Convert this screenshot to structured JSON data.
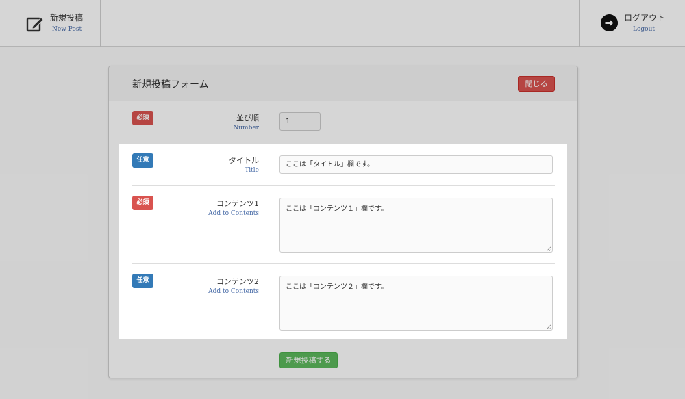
{
  "header": {
    "new_post_ja": "新規投稿",
    "new_post_en": "New Post",
    "new_post_icon": "edit-icon",
    "logout_ja": "ログアウト",
    "logout_en": "Logout",
    "logout_icon": "arrow-right-circle-icon"
  },
  "form": {
    "title": "新規投稿フォーム",
    "close_label": "閉じる",
    "submit_label": "新規投稿する",
    "fields": [
      {
        "badge": "必須",
        "badge_kind": "required",
        "label": "並び順",
        "sub": "Number",
        "value": "1",
        "type": "text"
      },
      {
        "badge": "任意",
        "badge_kind": "optional",
        "label": "タイトル",
        "sub": "Title",
        "value": "ここは「タイトル」欄です。",
        "type": "text"
      },
      {
        "badge": "必須",
        "badge_kind": "required",
        "label": "コンテンツ1",
        "sub": "Add to Contents",
        "value": "ここは「コンテンツ１」欄です。",
        "type": "textarea"
      },
      {
        "badge": "任意",
        "badge_kind": "optional",
        "label": "コンテンツ2",
        "sub": "Add to Contents",
        "value": "ここは「コンテンツ２」欄です。",
        "type": "textarea"
      }
    ]
  },
  "colors": {
    "required": "#d9534f",
    "optional": "#337ab7",
    "submit": "#5cb85c",
    "close": "#d9534f",
    "sub_label": "#4a6da8"
  }
}
